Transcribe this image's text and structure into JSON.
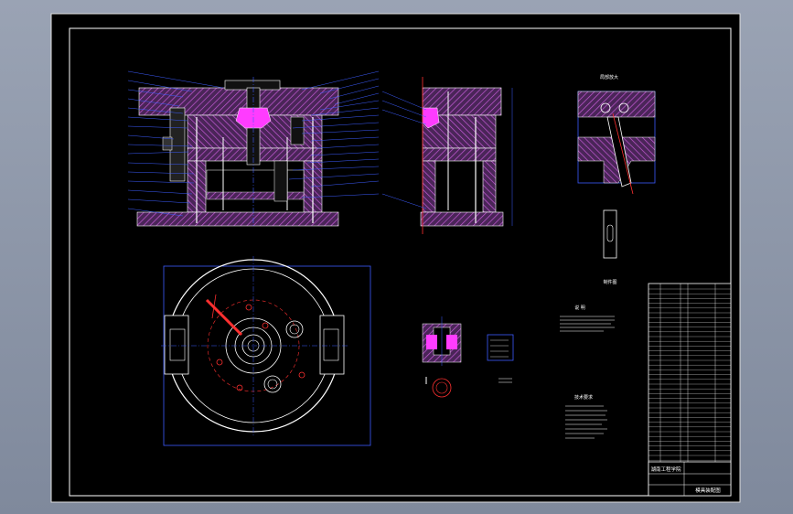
{
  "colors": {
    "background": "#8c96a8",
    "sheet": "#000000",
    "frame": "#ffffff",
    "hatch": "#c45ad6",
    "mould_fill": "#5a2a66",
    "highlight": "#ff3cff",
    "lines_white": "#ffffff",
    "lines_blue": "#3c5cff",
    "lines_red": "#ff3030",
    "table_text": "#ffffff"
  },
  "views": {
    "main_section": "assembly-section-view",
    "side_section": "side-section-view",
    "top_plan": "plan-view",
    "detail_pin": "detail-view",
    "part_view": "part-view"
  },
  "title_block": {
    "school": "湖南工程学院",
    "drawing_title": "模具装配图"
  },
  "detail_caption": "局部放大",
  "part_caption": "制件图",
  "tech_notes_title": "技术要求",
  "notes_heading": "说  明"
}
